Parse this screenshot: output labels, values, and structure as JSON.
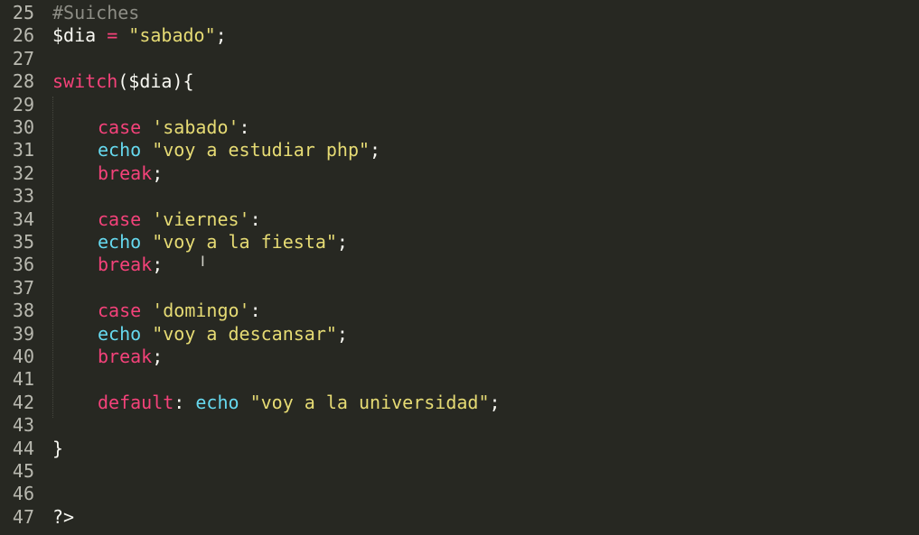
{
  "editor": {
    "colors": {
      "background": "#272822",
      "line_number": "#b9b9b0",
      "comment": "#8d8d85",
      "keyword": "#f4427a",
      "builtin": "#66d9ef",
      "string": "#e6db74",
      "text": "#f8f8f2"
    },
    "line_numbers": [
      "25",
      "26",
      "27",
      "28",
      "29",
      "30",
      "31",
      "32",
      "33",
      "34",
      "35",
      "36",
      "37",
      "38",
      "39",
      "40",
      "41",
      "42",
      "43",
      "44",
      "45",
      "46",
      "47"
    ],
    "code": {
      "l25": {
        "comment": "#Suiches"
      },
      "l26": {
        "var": "$dia",
        "op": " = ",
        "str": "\"sabado\"",
        "end": ";"
      },
      "l28": {
        "kw": "switch",
        "rest": "($dia){"
      },
      "l30": {
        "kw": "case",
        "str": " 'sabado'",
        "colon": ":"
      },
      "l31": {
        "fn": "echo",
        "str": " \"voy a estudiar php\"",
        "end": ";"
      },
      "l32": {
        "kw": "break",
        "end": ";"
      },
      "l34": {
        "kw": "case",
        "str": " 'viernes'",
        "colon": ":"
      },
      "l35": {
        "fn": "echo",
        "str": " \"voy a la fiesta\"",
        "end": ";"
      },
      "l36": {
        "kw": "break",
        "end": ";"
      },
      "l38": {
        "kw": "case",
        "str": " 'domingo'",
        "colon": ":"
      },
      "l39": {
        "fn": "echo",
        "str": " \"voy a descansar\"",
        "end": ";"
      },
      "l40": {
        "kw": "break",
        "end": ";"
      },
      "l42": {
        "kw": "default",
        "colon": ": ",
        "fn": "echo",
        "str": " \"voy a la universidad\"",
        "end": ";"
      },
      "l44": {
        "text": "}"
      },
      "l47": {
        "text": "?>"
      }
    },
    "cursor_icon": "text-cursor-icon"
  }
}
